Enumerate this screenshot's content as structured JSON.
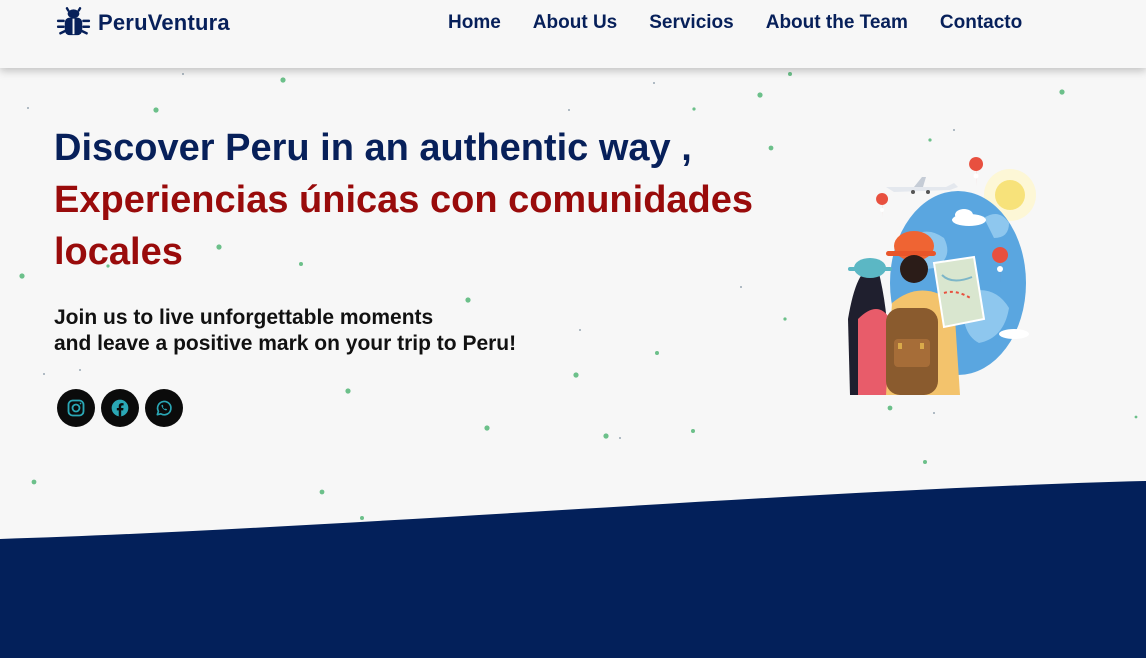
{
  "brand": {
    "name": "PeruVentura",
    "logo_icon": "bug-icon",
    "color": "#07205a"
  },
  "nav": {
    "items": [
      {
        "label": "Home"
      },
      {
        "label": "About Us"
      },
      {
        "label": "Servicios"
      },
      {
        "label": "About the Team"
      },
      {
        "label": "Contacto"
      }
    ]
  },
  "hero": {
    "title_en": "Discover Peru in an authentic way ,",
    "title_es": "Experiencias únicas con comunidades locales",
    "subtitle_line1": "Join us to live unforgettable moments",
    "subtitle_line2": "and leave a positive mark on your trip to Peru!",
    "title_en_color": "#07205a",
    "title_es_color": "#990b0b",
    "illustration": "travelers-globe-illustration"
  },
  "socials": [
    {
      "icon": "instagram-icon"
    },
    {
      "icon": "facebook-icon"
    },
    {
      "icon": "whatsapp-icon"
    }
  ],
  "colors": {
    "background": "#f7f7f7",
    "navy": "#03205a",
    "particle": "#6cc08a",
    "social_icon": "#2aa7b5"
  }
}
